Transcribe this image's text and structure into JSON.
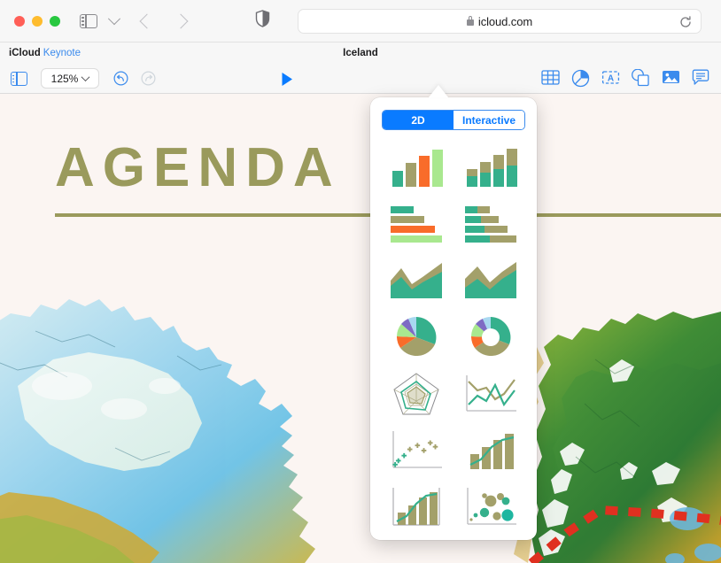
{
  "browser": {
    "window_controls": [
      "close",
      "minimize",
      "zoom"
    ],
    "sidebar_icon": "sidebar-icon",
    "tab_overview_icon": "chevron-down-icon",
    "back_icon": "back-arrow-icon",
    "forward_icon": "forward-arrow-icon",
    "shield_icon": "privacy-shield-icon",
    "url": "icloud.com",
    "lock_icon": "lock-icon",
    "reload_icon": "reload-icon"
  },
  "app": {
    "brand": "iCloud",
    "app_name": "Keynote",
    "document_title": "Iceland"
  },
  "toolbar": {
    "sidebar_label": "sidebar-toggle",
    "zoom_value": "125%",
    "undo_label": "undo",
    "redo_label": "redo",
    "play_label": "play",
    "tools": [
      {
        "name": "table-icon",
        "label": "Table"
      },
      {
        "name": "chart-icon",
        "label": "Chart",
        "active": true
      },
      {
        "name": "text-icon",
        "label": "Text"
      },
      {
        "name": "shape-icon",
        "label": "Shape"
      },
      {
        "name": "media-icon",
        "label": "Media"
      },
      {
        "name": "comment-icon",
        "label": "Comment"
      }
    ]
  },
  "slide": {
    "heading": "AGENDA"
  },
  "popover": {
    "segments": [
      {
        "label": "2D",
        "active": true
      },
      {
        "label": "Interactive",
        "active": false
      }
    ],
    "charts": [
      {
        "name": "column-chart",
        "label": "Column"
      },
      {
        "name": "stacked-column-chart",
        "label": "Stacked Column"
      },
      {
        "name": "bar-chart",
        "label": "Bar"
      },
      {
        "name": "stacked-bar-chart",
        "label": "Stacked Bar"
      },
      {
        "name": "area-chart",
        "label": "Area"
      },
      {
        "name": "stacked-area-chart",
        "label": "Stacked Area"
      },
      {
        "name": "pie-chart",
        "label": "Pie"
      },
      {
        "name": "donut-chart",
        "label": "Donut"
      },
      {
        "name": "radar-chart",
        "label": "Radar"
      },
      {
        "name": "line-chart",
        "label": "Line"
      },
      {
        "name": "scatter-chart",
        "label": "Scatter"
      },
      {
        "name": "mixed-chart",
        "label": "Mixed"
      },
      {
        "name": "two-axis-chart",
        "label": "2-Axis"
      },
      {
        "name": "bubble-chart",
        "label": "Bubble"
      }
    ]
  },
  "colors": {
    "accent_blue": "#0a7bff",
    "link_blue": "#3b8bed",
    "chart_teal": "#35b08c",
    "chart_olive": "#a3a06a",
    "chart_orange": "#f96c2a",
    "chart_lightgreen": "#a9e88f",
    "chart_purple": "#7e6bc4",
    "chart_lightblue": "#a8d8f0",
    "slide_bg": "#fbf5f2",
    "heading_olive": "#9a9a5c",
    "route_red": "#e03020"
  }
}
